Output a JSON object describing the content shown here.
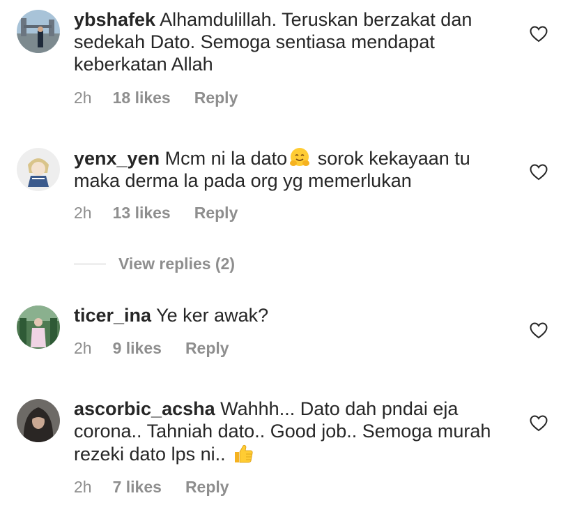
{
  "comments": [
    {
      "username": "ybshafek",
      "text_before": "Alhamdulillah. Teruskan berzakat dan sedekah Dato. Semoga sentiasa mendapat keberkatan Allah",
      "emoji": "",
      "text_after": "",
      "time": "2h",
      "likes": "18 likes",
      "reply": "Reply"
    },
    {
      "username": "yenx_yen",
      "text_before": "Mcm ni la dato",
      "emoji": "hugging-face-emoji",
      "text_after": " sorok kekayaan tu maka derma la pada org yg memerlukan",
      "time": "2h",
      "likes": "13 likes",
      "reply": "Reply"
    },
    {
      "username": "ticer_ina",
      "text_before": "Ye ker awak?",
      "emoji": "",
      "text_after": "",
      "time": "2h",
      "likes": "9 likes",
      "reply": "Reply"
    },
    {
      "username": "ascorbic_acsha",
      "text_before": "Wahhh... Dato dah pndai eja corona.. Tahniah dato.. Good job.. Semoga murah rezeki dato lps ni..",
      "emoji": "thumbs-up-emoji",
      "text_after": "",
      "time": "2h",
      "likes": "7 likes",
      "reply": "Reply"
    }
  ],
  "view_replies": "View replies (2)",
  "icons": {
    "like": "heart-outline-icon"
  },
  "colors": {
    "text": "#262626",
    "secondary": "#8e8e8e",
    "background": "#ffffff"
  }
}
